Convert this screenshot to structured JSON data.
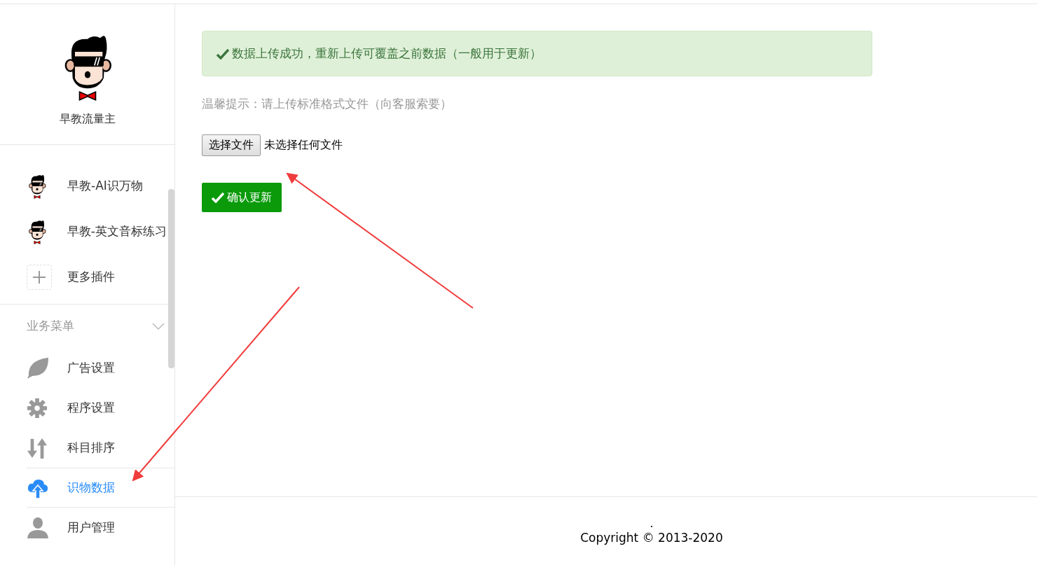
{
  "sidebar": {
    "brand": "早教流量主",
    "plugins": [
      {
        "kind": "avatar",
        "label": "早教-AI识万物"
      },
      {
        "kind": "avatar",
        "label": "早教-英文音标练习"
      },
      {
        "kind": "add",
        "label": "更多插件"
      }
    ],
    "section": {
      "title": "业务菜单",
      "expanded": true
    },
    "items": [
      {
        "label": "广告设置",
        "selected": false
      },
      {
        "label": "程序设置",
        "selected": false
      },
      {
        "label": "科目排序",
        "selected": false
      },
      {
        "label": "识物数据",
        "selected": true
      },
      {
        "label": "用户管理",
        "selected": false
      }
    ]
  },
  "main": {
    "alert": "数据上传成功，重新上传可覆盖之前数据（一般用于更新）",
    "hint": "温馨提示：请上传标准格式文件（向客服索要）",
    "file_button": "选择文件",
    "file_status": "未选择任何文件",
    "confirm_button": "确认更新"
  },
  "footer": {
    "dot": ".",
    "copyright": "Copyright © 2013-2020"
  }
}
